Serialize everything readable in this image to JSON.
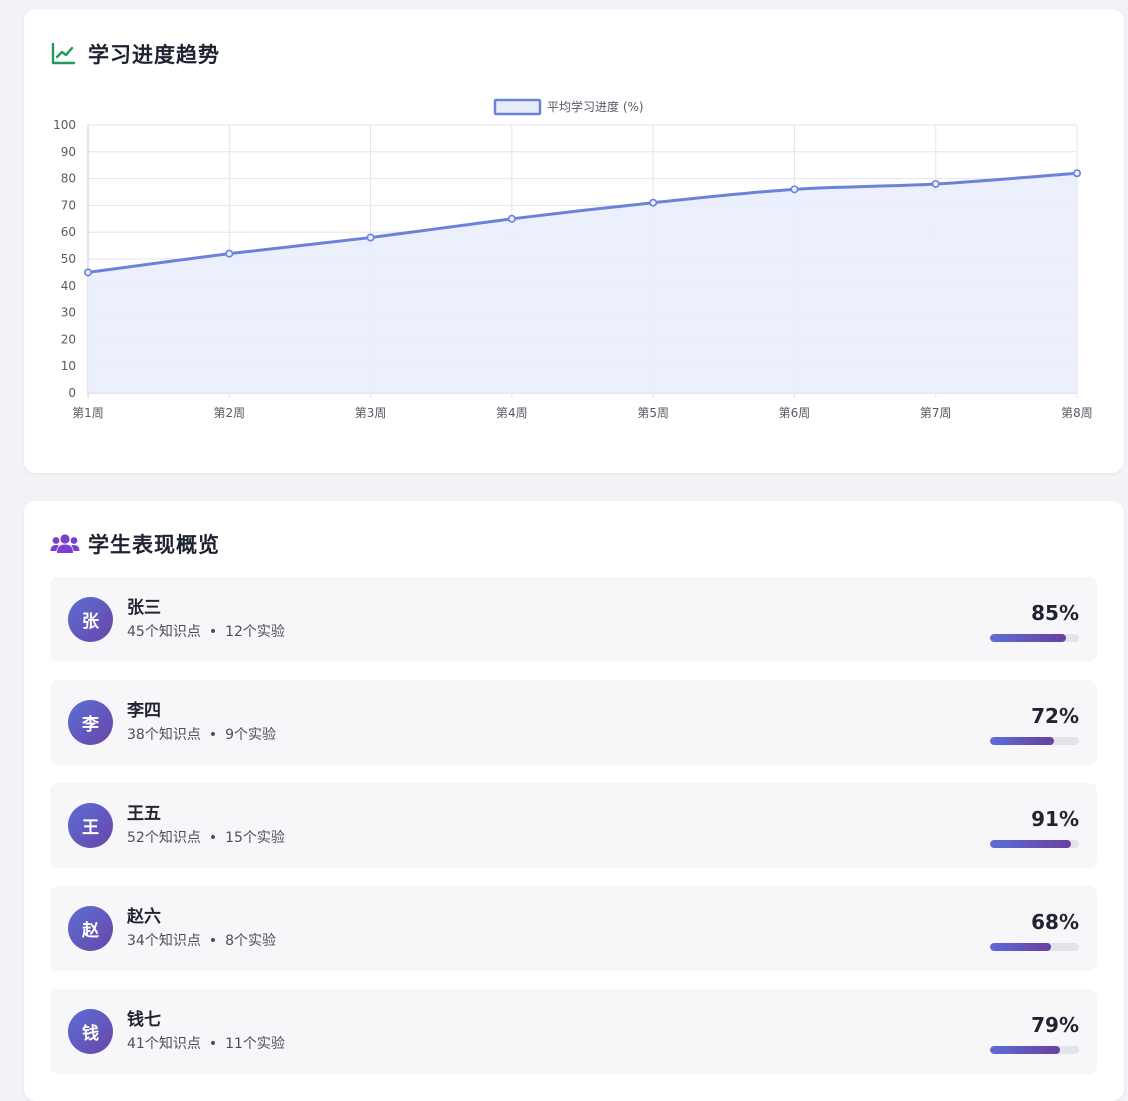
{
  "trend_section": {
    "title": "学习进度趋势",
    "icon": "line-chart-icon"
  },
  "chart_data": {
    "type": "area",
    "categories": [
      "第1周",
      "第2周",
      "第3周",
      "第4周",
      "第5周",
      "第6周",
      "第7周",
      "第8周"
    ],
    "series": [
      {
        "name": "平均学习进度 (%)",
        "values": [
          45,
          52,
          58,
          65,
          71,
          76,
          78,
          82
        ]
      }
    ],
    "title": "",
    "xlabel": "",
    "ylabel": "",
    "ylim": [
      0,
      100
    ],
    "yticks": [
      0,
      10,
      20,
      30,
      40,
      50,
      60,
      70,
      80,
      90,
      100
    ],
    "grid": true,
    "legend_position": "top-center",
    "colors": {
      "line": "#6b82d8",
      "fill": "#e8edfb"
    }
  },
  "performance_section": {
    "title": "学生表现概览",
    "icon": "users-icon",
    "students": [
      {
        "avatar": "张",
        "name": "张三",
        "knowledge": "45个知识点",
        "labs": "12个实验",
        "score_text": "85%",
        "score": 85
      },
      {
        "avatar": "李",
        "name": "李四",
        "knowledge": "38个知识点",
        "labs": "9个实验",
        "score_text": "72%",
        "score": 72
      },
      {
        "avatar": "王",
        "name": "王五",
        "knowledge": "52个知识点",
        "labs": "15个实验",
        "score_text": "91%",
        "score": 91
      },
      {
        "avatar": "赵",
        "name": "赵六",
        "knowledge": "34个知识点",
        "labs": "8个实验",
        "score_text": "68%",
        "score": 68
      },
      {
        "avatar": "钱",
        "name": "钱七",
        "knowledge": "41个知识点",
        "labs": "11个实验",
        "score_text": "79%",
        "score": 79
      }
    ]
  },
  "colors": {
    "accent_blue": "#5b6ed6",
    "accent_purple": "#6a45a8",
    "trend_icon": "#1f9d55",
    "users_icon": "#7b3fd0"
  }
}
